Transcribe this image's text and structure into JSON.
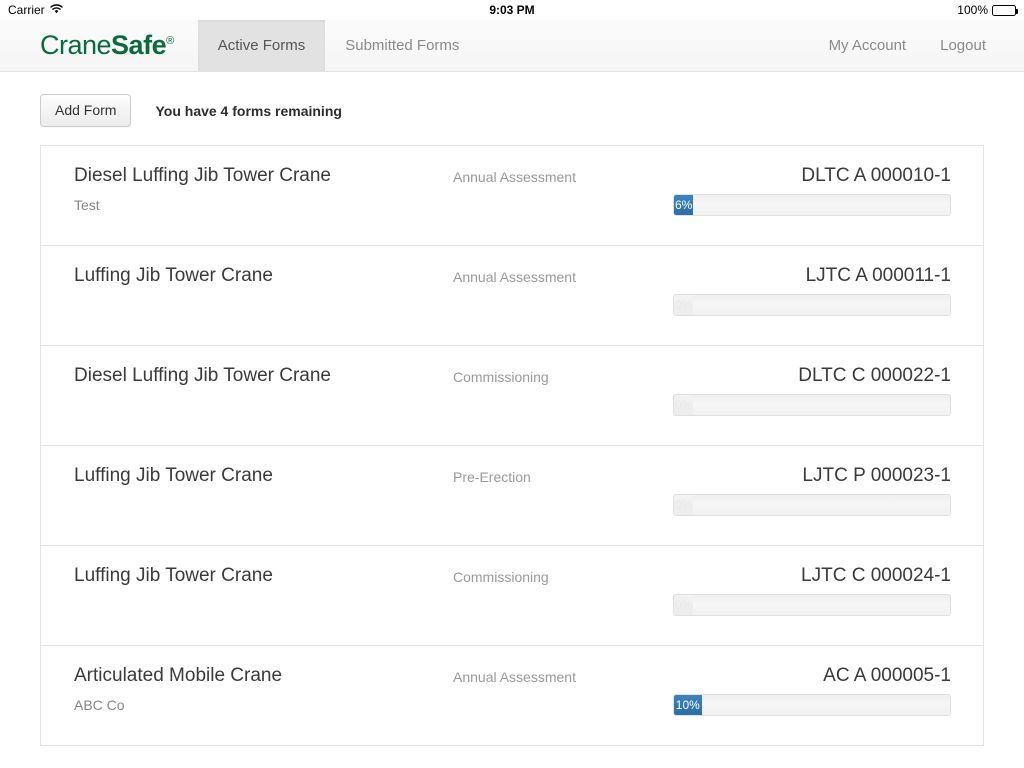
{
  "status_bar": {
    "carrier": "Carrier",
    "wifi_icon": "wifi-icon",
    "time": "9:03 PM",
    "battery_percent": "100%",
    "battery_icon": "battery-full-icon"
  },
  "header": {
    "brand": {
      "part1": "Crane",
      "part2": "Safe",
      "registered": "®",
      "color": "#0a6b3d"
    },
    "tabs": [
      {
        "label": "Active Forms",
        "active": true
      },
      {
        "label": "Submitted Forms",
        "active": false
      }
    ],
    "account_links": [
      {
        "label": "My Account"
      },
      {
        "label": "Logout"
      }
    ]
  },
  "toolbar": {
    "add_form_label": "Add Form",
    "forms_remaining": "You have 4 forms remaining"
  },
  "forms": [
    {
      "title": "Diesel Luffing Jib Tower Crane",
      "subtitle": "Test",
      "type": "Annual Assessment",
      "code": "DLTC A 000010-1",
      "progress": 6,
      "progress_label": "6%"
    },
    {
      "title": "Luffing Jib Tower Crane",
      "subtitle": "",
      "type": "Annual Assessment",
      "code": "LJTC A 000011-1",
      "progress": 0,
      "progress_label": "0%"
    },
    {
      "title": "Diesel Luffing Jib Tower Crane",
      "subtitle": "",
      "type": "Commissioning",
      "code": "DLTC C 000022-1",
      "progress": 0,
      "progress_label": "0%"
    },
    {
      "title": "Luffing Jib Tower Crane",
      "subtitle": "",
      "type": "Pre-Erection",
      "code": "LJTC P 000023-1",
      "progress": 0,
      "progress_label": "0%"
    },
    {
      "title": "Luffing Jib Tower Crane",
      "subtitle": "",
      "type": "Commissioning",
      "code": "LJTC C 000024-1",
      "progress": 0,
      "progress_label": "0%"
    },
    {
      "title": "Articulated Mobile Crane",
      "subtitle": "ABC Co",
      "type": "Annual Assessment",
      "code": "AC A 000005-1",
      "progress": 10,
      "progress_label": "10%"
    }
  ],
  "colors": {
    "brand_green": "#0a6b3d",
    "progress_blue": "#2d6ea5",
    "active_tab_bg": "#e2e2e2"
  }
}
